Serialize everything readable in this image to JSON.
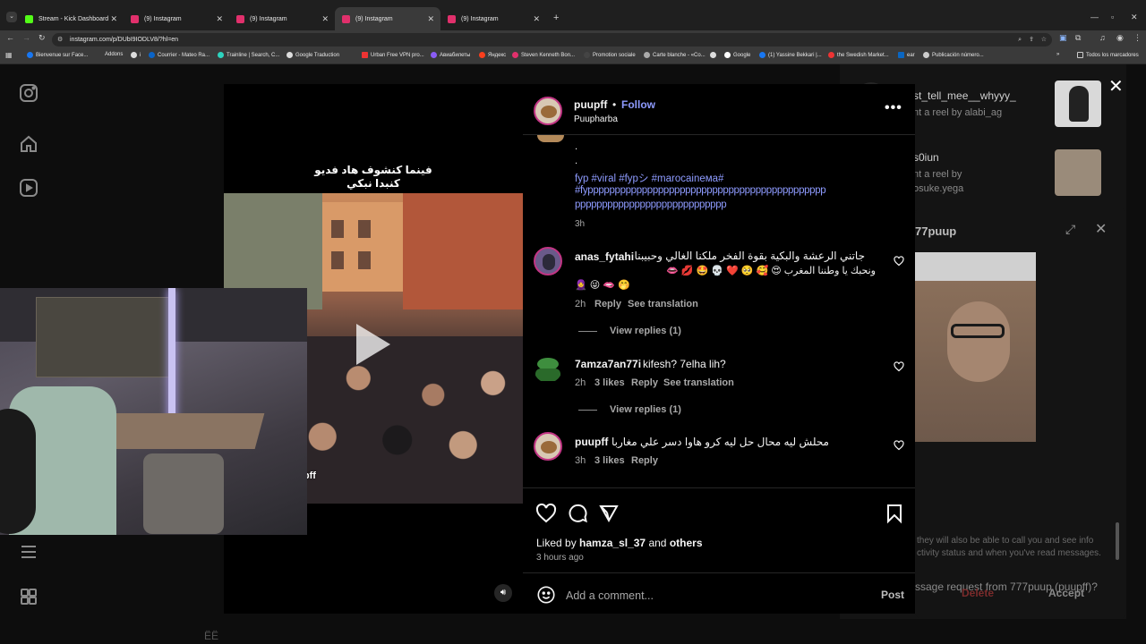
{
  "browser": {
    "tabs": [
      {
        "title": "Stream - Kick Dashboard",
        "color": "#53fc18"
      },
      {
        "title": "(9) Instagram",
        "color": "#e1306c"
      },
      {
        "title": "(9) Instagram",
        "color": "#e1306c"
      },
      {
        "title": "(9) Instagram",
        "color": "#e1306c"
      },
      {
        "title": "(9) Instagram",
        "color": "#e1306c"
      }
    ],
    "url": "instagram.com/p/DUbI9IODLV8/?hl=en",
    "bookmarks": [
      "Bienvenue sur Face...",
      "Addons",
      "i",
      "Courrier - Mateo Ra...",
      "Trainline | Search, C...",
      "Google Traduction",
      "Urban Free VPN pro...",
      "Авиабилеты",
      "Яндекс",
      "Steven Kenneth Bon...",
      "Promotion sociale",
      "Carte blanche - «Co...",
      "Google",
      "(1) Yassine Bekkari |...",
      "the Swedish Market...",
      "ear",
      "Publicación número..."
    ],
    "all_bookmarks": "Todos los marcadores"
  },
  "post": {
    "username": "puupff",
    "follow": "Follow",
    "subtitle": "Puupharba",
    "video_caption_line1": "فينما كنشوف هاد فديو",
    "video_caption_line2": "كنبدا نبكي",
    "watermark": "@puupff",
    "caption_dots": [
      ".",
      "."
    ],
    "caption_tags_line1": "fyp #viral #fypシ #marocaineмa#",
    "caption_tags_line2": "#fypppppppppppppppppppppppppppppppppppppppppppp",
    "caption_tags_line3": "pppppppppppppppppppppppppppp",
    "caption_time": "3h",
    "comments": [
      {
        "user": "anas_fytahi",
        "text1": "جاتني الرعشة والبكية بقوة الفخر ملكنا الغالي وحبيبنا",
        "text2": "ونحبك يا وطننا المغرب 😍 🥰 🥺 ❤️ 💀 🤩 💋 👄",
        "text3": "🧕 😜 🫦 🤭",
        "time": "2h",
        "likes": "",
        "reply": "Reply",
        "translate": "See translation",
        "replies": "View replies (1)"
      },
      {
        "user": "7amza7an77i",
        "text1": "kifesh? 7elha lih?",
        "time": "2h",
        "likes": "3 likes",
        "reply": "Reply",
        "translate": "See translation",
        "replies": "View replies (1)"
      },
      {
        "user": "puupff",
        "text1": "محلش ليه محال حل ليه كرو هاوا دسر علي مغاربا",
        "time": "3h",
        "likes": "3 likes",
        "reply": "Reply"
      }
    ],
    "liked_by_prefix": "Liked by",
    "liked_by_user": "hamza_sl_37",
    "liked_by_and": "and",
    "liked_by_others": "others",
    "posted_ago": "3 hours ago",
    "add_comment_placeholder": "Add a comment...",
    "post_button": "Post"
  },
  "background": {
    "reel1_user": "st_tell_mee__whyyy_",
    "reel1_sub": "nt a reel by alabi_ag",
    "reel2_user": "s0iun",
    "reel2_sub1": "nt a reel by",
    "reel2_sub2": "osuke.yega",
    "chat_title": "77puup",
    "message_request": "ssage request from 777puup (puupff)?",
    "request_line2": "they will also be able to call you and see info",
    "request_line3": "ctivity status and when you've read messages.",
    "delete": "Delete",
    "accept": "Accept",
    "bottom_text": "ЁЁ"
  }
}
